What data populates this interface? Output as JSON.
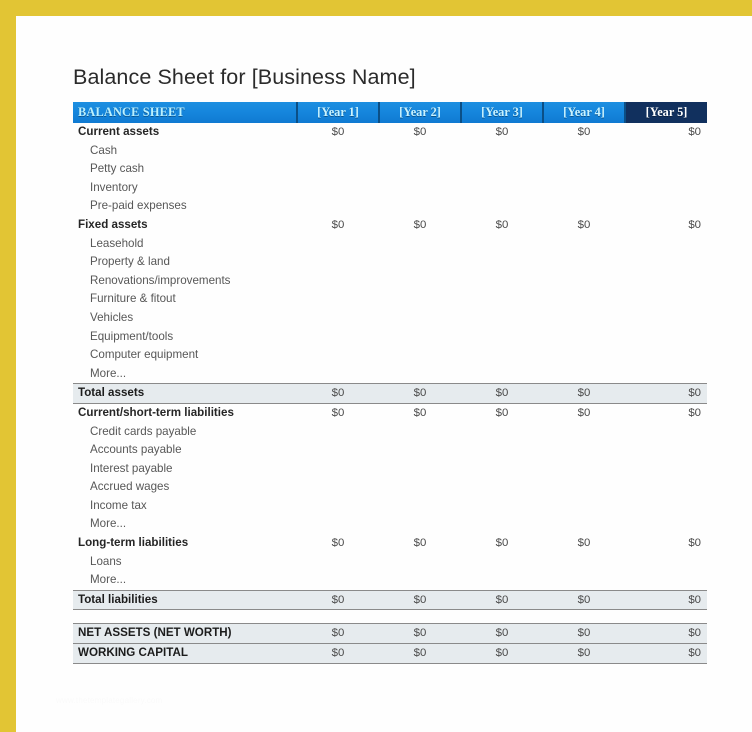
{
  "document": {
    "title": "Balance Sheet for [Business Name]",
    "watermark": "www.thetemplategallery.com"
  },
  "colors": {
    "frame": "#e2c534",
    "header_blue": "#1686dd",
    "header_last_navy": "#11305e",
    "band_gray": "#e6ebee",
    "header_text": "#c9f3ff"
  },
  "table": {
    "header": {
      "label": "BALANCE SHEET",
      "years": [
        "[Year 1]",
        "[Year 2]",
        "[Year 3]",
        "[Year 4]",
        "[Year 5]"
      ]
    },
    "rows": [
      {
        "label": "Current assets",
        "style": "head",
        "values": [
          "$0",
          "$0",
          "$0",
          "$0",
          "$0"
        ]
      },
      {
        "label": "Cash",
        "style": "item",
        "values": [
          "",
          "",
          "",
          "",
          ""
        ]
      },
      {
        "label": "Petty cash",
        "style": "item",
        "values": [
          "",
          "",
          "",
          "",
          ""
        ]
      },
      {
        "label": "Inventory",
        "style": "item",
        "values": [
          "",
          "",
          "",
          "",
          ""
        ]
      },
      {
        "label": "Pre-paid expenses",
        "style": "item",
        "values": [
          "",
          "",
          "",
          "",
          ""
        ]
      },
      {
        "label": "Fixed assets",
        "style": "head",
        "values": [
          "$0",
          "$0",
          "$0",
          "$0",
          "$0"
        ]
      },
      {
        "label": "Leasehold",
        "style": "item",
        "values": [
          "",
          "",
          "",
          "",
          ""
        ]
      },
      {
        "label": "Property & land",
        "style": "item",
        "values": [
          "",
          "",
          "",
          "",
          ""
        ]
      },
      {
        "label": "Renovations/improvements",
        "style": "item",
        "values": [
          "",
          "",
          "",
          "",
          ""
        ]
      },
      {
        "label": "Furniture & fitout",
        "style": "item",
        "values": [
          "",
          "",
          "",
          "",
          ""
        ]
      },
      {
        "label": "Vehicles",
        "style": "item",
        "values": [
          "",
          "",
          "",
          "",
          ""
        ]
      },
      {
        "label": "Equipment/tools",
        "style": "item",
        "values": [
          "",
          "",
          "",
          "",
          ""
        ]
      },
      {
        "label": "Computer equipment",
        "style": "item",
        "values": [
          "",
          "",
          "",
          "",
          ""
        ]
      },
      {
        "label": "More...",
        "style": "item",
        "values": [
          "",
          "",
          "",
          "",
          ""
        ]
      },
      {
        "label": "Total assets",
        "style": "total",
        "band": true,
        "values": [
          "$0",
          "$0",
          "$0",
          "$0",
          "$0"
        ]
      },
      {
        "label": "Current/short-term liabilities",
        "style": "head",
        "values": [
          "$0",
          "$0",
          "$0",
          "$0",
          "$0"
        ]
      },
      {
        "label": "Credit cards payable",
        "style": "item",
        "values": [
          "",
          "",
          "",
          "",
          ""
        ]
      },
      {
        "label": "Accounts payable",
        "style": "item",
        "values": [
          "",
          "",
          "",
          "",
          ""
        ]
      },
      {
        "label": "Interest payable",
        "style": "item",
        "values": [
          "",
          "",
          "",
          "",
          ""
        ]
      },
      {
        "label": "Accrued wages",
        "style": "item",
        "values": [
          "",
          "",
          "",
          "",
          ""
        ]
      },
      {
        "label": "Income tax",
        "style": "item",
        "values": [
          "",
          "",
          "",
          "",
          ""
        ]
      },
      {
        "label": "More...",
        "style": "item",
        "values": [
          "",
          "",
          "",
          "",
          ""
        ]
      },
      {
        "label": "Long-term liabilities",
        "style": "head",
        "values": [
          "$0",
          "$0",
          "$0",
          "$0",
          "$0"
        ]
      },
      {
        "label": "Loans",
        "style": "item",
        "values": [
          "",
          "",
          "",
          "",
          ""
        ]
      },
      {
        "label": "More...",
        "style": "item",
        "values": [
          "",
          "",
          "",
          "",
          ""
        ]
      },
      {
        "label": "Total liabilities",
        "style": "total",
        "band": true,
        "values": [
          "$0",
          "$0",
          "$0",
          "$0",
          "$0"
        ]
      },
      {
        "label": "",
        "style": "spacer",
        "values": [
          "",
          "",
          "",
          "",
          ""
        ]
      },
      {
        "label": "NET ASSETS (NET WORTH)",
        "style": "total",
        "band": true,
        "values": [
          "$0",
          "$0",
          "$0",
          "$0",
          "$0"
        ]
      },
      {
        "label": "WORKING CAPITAL",
        "style": "total",
        "band": true,
        "values": [
          "$0",
          "$0",
          "$0",
          "$0",
          "$0"
        ]
      }
    ]
  }
}
